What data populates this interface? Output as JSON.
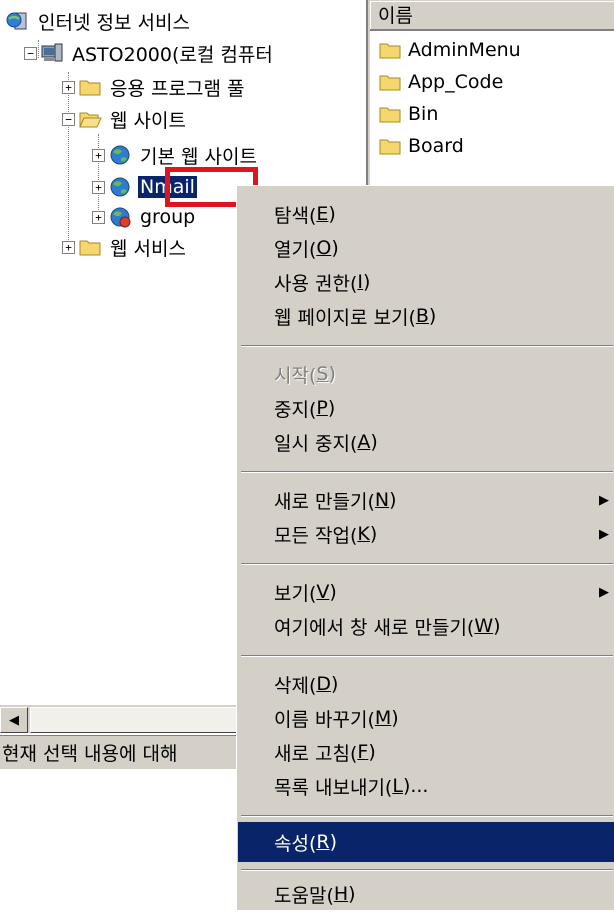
{
  "tree": {
    "root": "인터넷 정보 서비스",
    "computer": "ASTO2000(로컬 컴퓨터",
    "app_pools": "응용 프로그램 풀",
    "web_sites": "웹 사이트",
    "default_site": "기본 웹 사이트",
    "nmail": "Nmail",
    "group": "group",
    "web_services": "웹 서비스"
  },
  "list": {
    "column_name": "이름",
    "items": [
      "AdminMenu",
      "App_Code",
      "Bin",
      "Board"
    ]
  },
  "status_text": "현재 선택 내용에 대해",
  "menu": {
    "explore": {
      "pre": "탐색(",
      "key": "E",
      "post": ")"
    },
    "open": {
      "pre": "열기(",
      "key": "O",
      "post": ")"
    },
    "permissions": {
      "pre": "사용 권한(",
      "key": "I",
      "post": ")"
    },
    "browse": {
      "pre": "웹 페이지로 보기(",
      "key": "B",
      "post": ")"
    },
    "start": {
      "pre": "시작(",
      "key": "S",
      "post": ")"
    },
    "stop": {
      "pre": "중지(",
      "key": "P",
      "post": ")"
    },
    "pause": {
      "pre": "일시 중지(",
      "key": "A",
      "post": ")"
    },
    "new": {
      "pre": "새로 만들기(",
      "key": "N",
      "post": ")"
    },
    "all_tasks": {
      "pre": "모든 작업(",
      "key": "K",
      "post": ")"
    },
    "view": {
      "pre": "보기(",
      "key": "V",
      "post": ")"
    },
    "new_window": {
      "pre": "여기에서 창 새로 만들기(",
      "key": "W",
      "post": ")"
    },
    "delete": {
      "pre": "삭제(",
      "key": "D",
      "post": ")"
    },
    "rename": {
      "pre": "이름 바꾸기(",
      "key": "M",
      "post": ")"
    },
    "refresh": {
      "pre": "새로 고침(",
      "key": "F",
      "post": ")"
    },
    "export": {
      "pre": "목록 내보내기(",
      "key": "L",
      "post": ")..."
    },
    "properties": {
      "pre": "속성(",
      "key": "R",
      "post": ")"
    },
    "help": {
      "pre": "도움말(",
      "key": "H",
      "post": ")"
    }
  },
  "colors": {
    "menu_bg": "#d4d0c8",
    "highlight": "#0a246a",
    "annotation_red": "#e0141e"
  }
}
